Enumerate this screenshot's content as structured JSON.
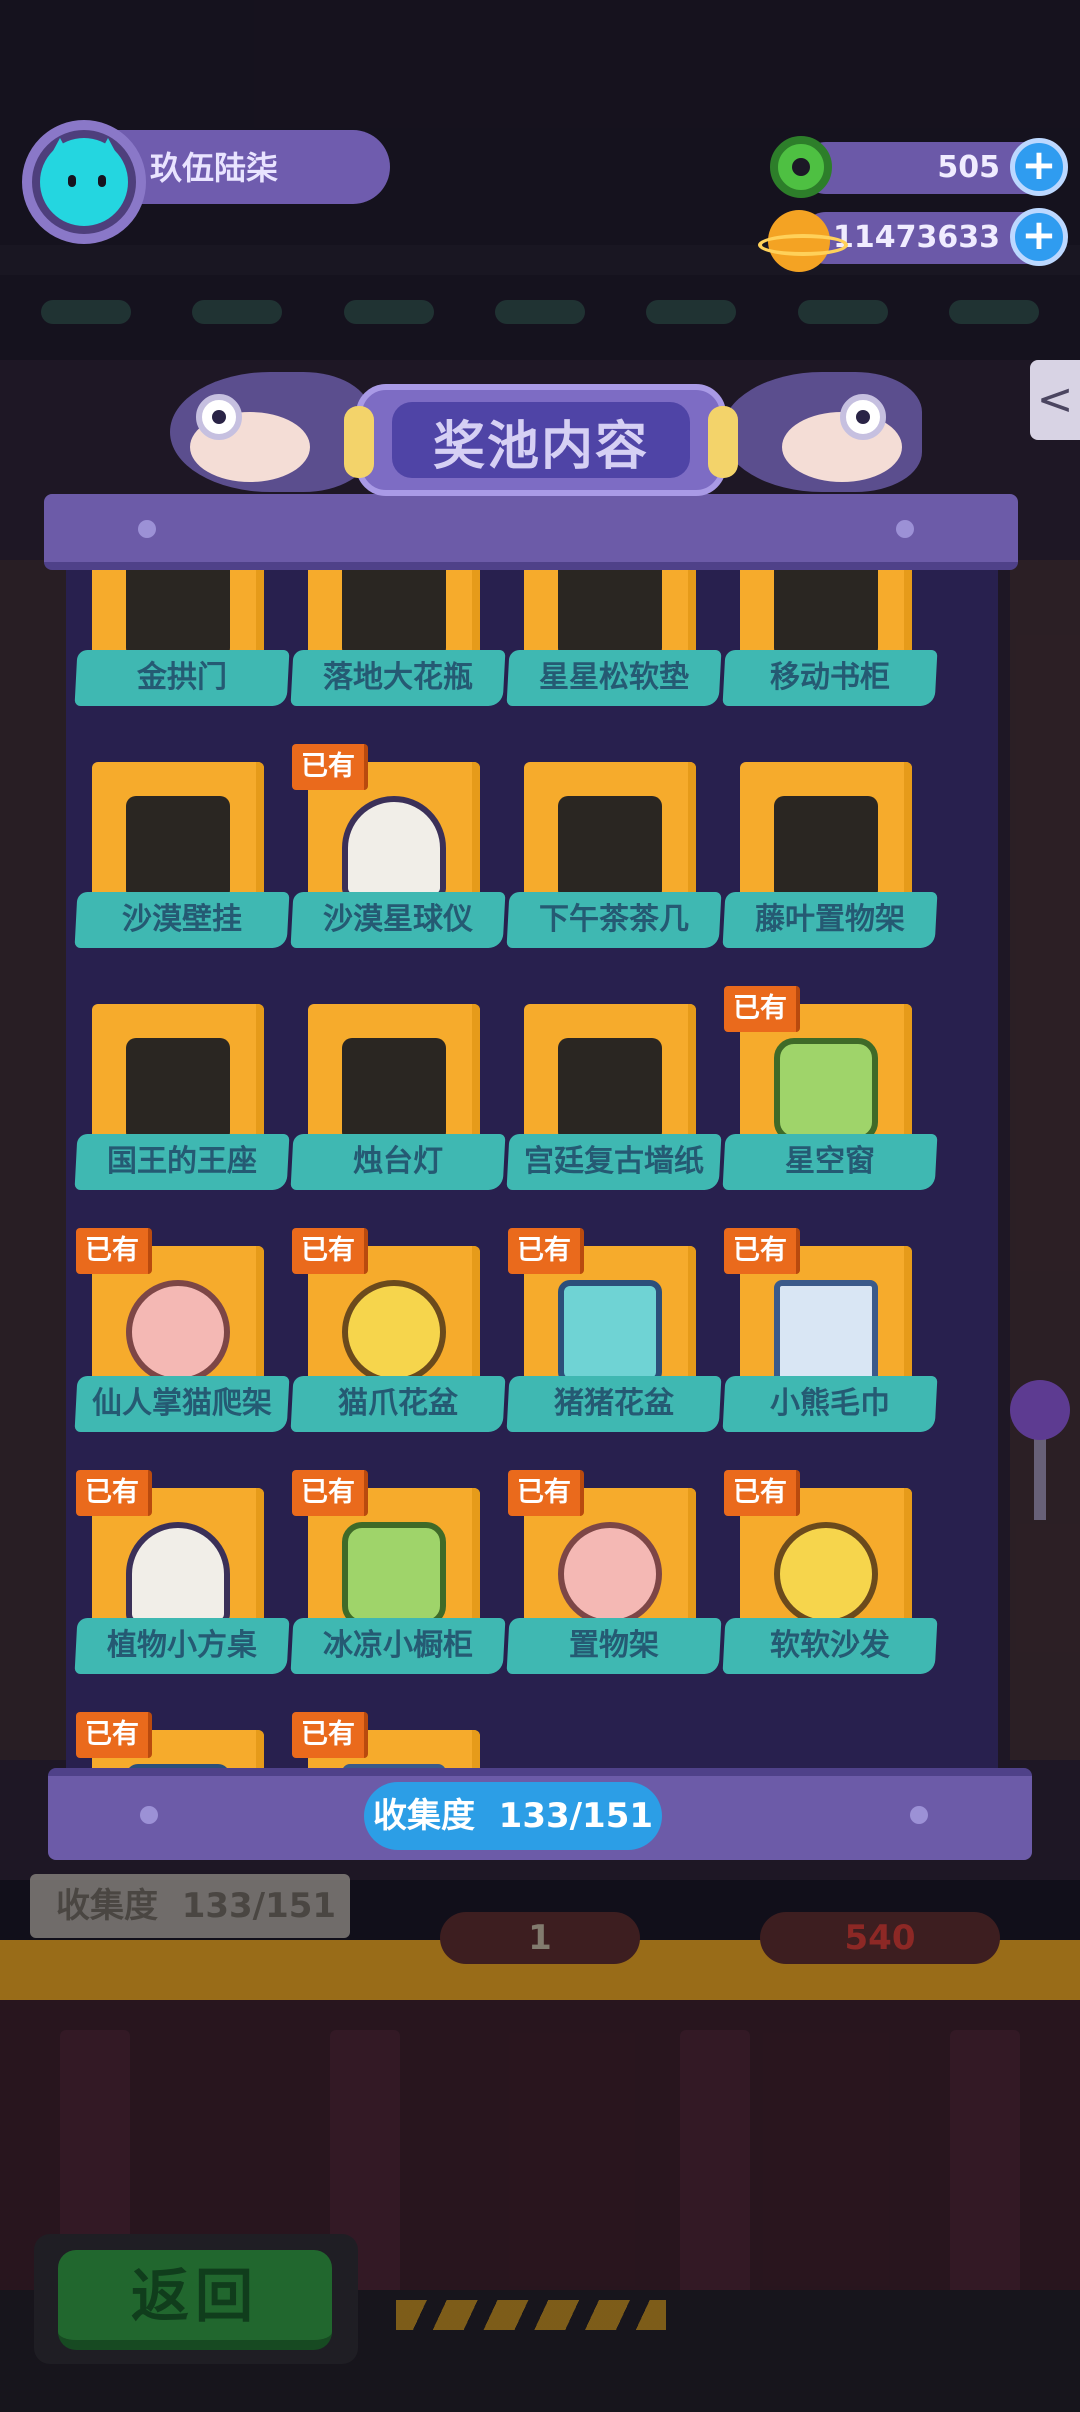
{
  "header": {
    "player_name": "玖伍陆柒",
    "currencies": [
      {
        "icon": "green-ring-coin-icon",
        "value": "505"
      },
      {
        "icon": "planet-coin-icon",
        "value": "11473633"
      }
    ],
    "plus_symbol": "+"
  },
  "panel": {
    "title": "奖池内容",
    "owned_tag": "已有",
    "collection": {
      "label": "收集度",
      "value": "133/151"
    }
  },
  "items": [
    {
      "name": "金拱门",
      "owned": false,
      "partial": true
    },
    {
      "name": "落地大花瓶",
      "owned": false,
      "partial": true
    },
    {
      "name": "星星松软垫",
      "owned": false,
      "partial": true
    },
    {
      "name": "移动书柜",
      "owned": false,
      "partial": true
    },
    {
      "name": "沙漠壁挂",
      "owned": false
    },
    {
      "name": "沙漠星球仪",
      "owned": true
    },
    {
      "name": "下午茶茶几",
      "owned": false
    },
    {
      "name": "藤叶置物架",
      "owned": false
    },
    {
      "name": "国王的王座",
      "owned": false
    },
    {
      "name": "烛台灯",
      "owned": false
    },
    {
      "name": "宫廷复古墙纸",
      "owned": false
    },
    {
      "name": "星空窗",
      "owned": true
    },
    {
      "name": "仙人掌猫爬架",
      "owned": true
    },
    {
      "name": "猫爪花盆",
      "owned": true
    },
    {
      "name": "猪猪花盆",
      "owned": true
    },
    {
      "name": "小熊毛巾",
      "owned": true
    },
    {
      "name": "植物小方桌",
      "owned": true
    },
    {
      "name": "冰凉小橱柜",
      "owned": true
    },
    {
      "name": "置物架",
      "owned": true
    },
    {
      "name": "软软沙发",
      "owned": true
    },
    {
      "name": "",
      "owned": true,
      "partial_bottom": true
    },
    {
      "name": "",
      "owned": true,
      "partial_bottom": true
    }
  ],
  "background": {
    "collect_label": "收集度",
    "collect_value": "133/151",
    "pill_left_value": "1",
    "pill_right_value": "540",
    "back_button": "返回"
  },
  "colors": {
    "panel_purple": "#6c5ba8",
    "panel_body": "#28204e",
    "tile_orange": "#f6ab2c",
    "label_teal": "#3fb8b2",
    "owned_orange": "#ea6a1c",
    "pill_blue": "#2c9ee6"
  }
}
